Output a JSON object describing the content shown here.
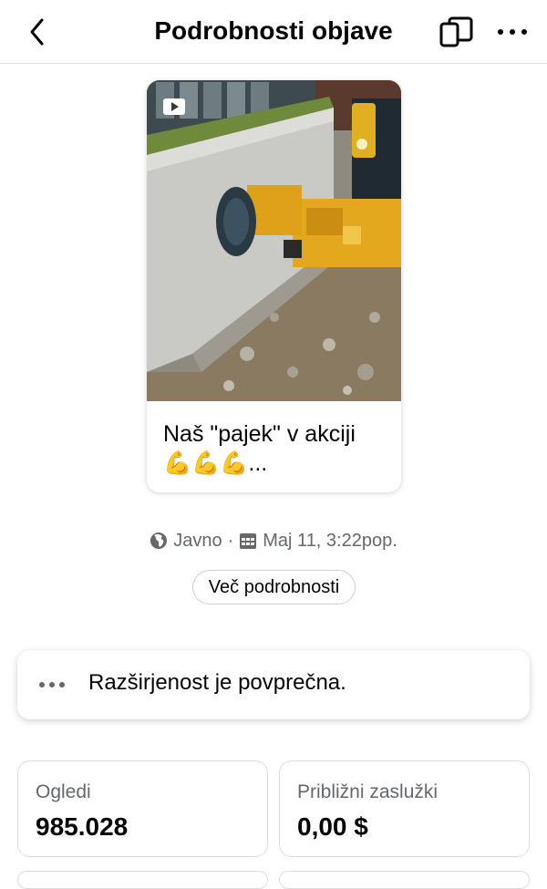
{
  "header": {
    "title": "Podrobnosti objave"
  },
  "post": {
    "caption_line1": "Naš \"pajek\" v akciji",
    "caption_line2": "💪💪💪...",
    "thumbnail_description_icon": "video-icon"
  },
  "meta": {
    "visibility": "Javno",
    "separator": "·",
    "date": "Maj 11, 3:22pop."
  },
  "details_button": {
    "label": "Več podrobnosti"
  },
  "reach": {
    "text": "Razširjenost je povprečna."
  },
  "stats": [
    {
      "label": "Ogledi",
      "value": "985.028"
    },
    {
      "label": "Približni zaslužki",
      "value": "0,00 $"
    }
  ]
}
